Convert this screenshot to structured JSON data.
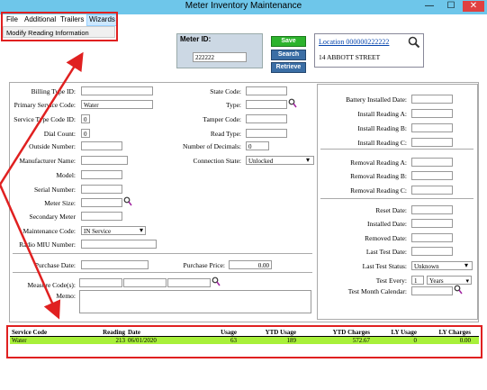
{
  "window": {
    "title": "Meter Inventory Maintenance",
    "minimize": "—",
    "maximize": "☐",
    "close": "✕"
  },
  "menu": {
    "items": [
      "File",
      "Additional",
      "Trailers",
      "Wizards"
    ],
    "dropdown_item": "Modify Reading Information"
  },
  "meter": {
    "label": "Meter ID:",
    "value": "222222"
  },
  "buttons": {
    "save": "Save",
    "search": "Search",
    "retrieve": "Retrieve"
  },
  "location": {
    "link": "Location 000000222222",
    "address": "14 ABBOTT STREET"
  },
  "left_fields": [
    {
      "label": "Billing Type ID:",
      "value": ""
    },
    {
      "label": "Primary Service Code:",
      "value": "Water"
    },
    {
      "label": "Service Type Code ID:",
      "value": "0"
    },
    {
      "label": "Dial Count:",
      "value": "0"
    },
    {
      "label": "Outside Number:",
      "value": ""
    },
    {
      "label": "Manufacturer Name:",
      "value": ""
    },
    {
      "label": "Model:",
      "value": ""
    },
    {
      "label": "Serial Number:",
      "value": ""
    },
    {
      "label": "Meter Size:",
      "value": ""
    },
    {
      "label": "Secondary Meter",
      "value": ""
    },
    {
      "label": "Maintenance Code:",
      "value": "IN Service"
    },
    {
      "label": "Radio MIU Number:",
      "value": ""
    }
  ],
  "mid_fields": [
    {
      "label": "State Code:",
      "value": ""
    },
    {
      "label": "Type:",
      "value": ""
    },
    {
      "label": "Tamper Code:",
      "value": ""
    },
    {
      "label": "Read Type:",
      "value": ""
    },
    {
      "label": "Number of Decimals:",
      "value": "0"
    },
    {
      "label": "Connection State:",
      "value": "Unlocked"
    }
  ],
  "purchase": {
    "date_label": "Purchase Date:",
    "date_value": "",
    "price_label": "Purchase Price:",
    "price_value": "0.00"
  },
  "measure": {
    "label": "Measure Code(s):",
    "memo_label": "Memo:"
  },
  "right_fields": [
    {
      "label": "Battery Installed Date:",
      "value": ""
    },
    {
      "label": "Install Reading A:",
      "value": ""
    },
    {
      "label": "Install Reading B:",
      "value": ""
    },
    {
      "label": "Install Reading C:",
      "value": ""
    },
    {
      "label": "Removal Reading A:",
      "value": ""
    },
    {
      "label": "Removal Reading B:",
      "value": ""
    },
    {
      "label": "Removal Reading C:",
      "value": ""
    },
    {
      "label": "Reset Date:",
      "value": ""
    },
    {
      "label": "Installed Date:",
      "value": ""
    },
    {
      "label": "Removed Date:",
      "value": ""
    },
    {
      "label": "Last Test Date:",
      "value": ""
    },
    {
      "label": "Last Test Status:",
      "value": "Unknown"
    },
    {
      "label": "Test Every:",
      "value": "1"
    },
    {
      "label": "Test Month Calendar:",
      "value": ""
    }
  ],
  "test_every_unit": "Years",
  "grid": {
    "headers": [
      "Service Code",
      "Reading",
      "Date",
      "Usage",
      "YTD Usage",
      "YTD Charges",
      "LY Usage",
      "LY Charges"
    ],
    "rows": [
      [
        "Water",
        "213",
        "06/01/2020",
        "63",
        "189",
        "572.67",
        "0",
        "0.00"
      ]
    ]
  },
  "colors": {
    "titlebar": "#6ec6ea",
    "highlight_row": "#a8f03a",
    "annotation": "#e02020",
    "save": "#2db32d",
    "search": "#3b6ea5"
  }
}
